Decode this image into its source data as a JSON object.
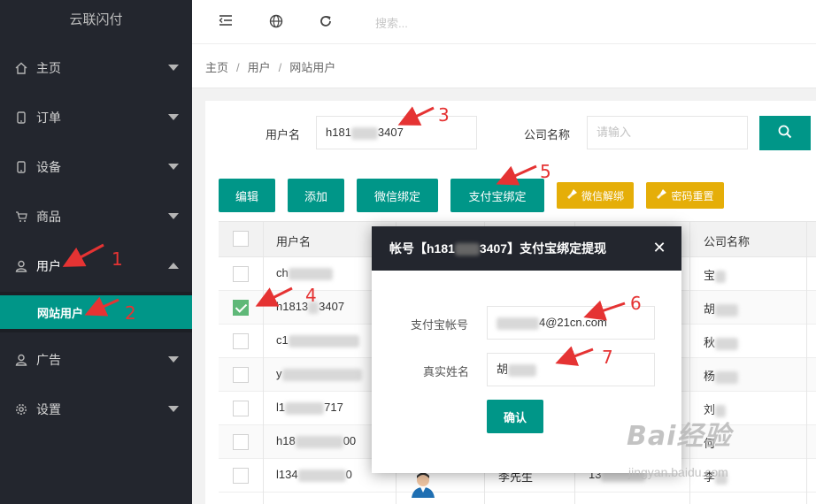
{
  "app": {
    "brand": "云联闪付"
  },
  "sidebar": {
    "items": [
      {
        "label": "主页",
        "icon": "home-icon"
      },
      {
        "label": "订单",
        "icon": "phone-icon"
      },
      {
        "label": "设备",
        "icon": "phone-icon"
      },
      {
        "label": "商品",
        "icon": "cart-icon"
      },
      {
        "label": "用户",
        "icon": "user-icon"
      },
      {
        "label": "广告",
        "icon": "user-icon"
      },
      {
        "label": "设置",
        "icon": "gear-icon"
      }
    ],
    "sub_item": "网站用户"
  },
  "header": {
    "search_placeholder": "搜索..."
  },
  "breadcrumb": {
    "home": "主页",
    "section": "用户",
    "current": "网站用户"
  },
  "filter": {
    "username_label": "用户名",
    "username_value_prefix": "h181",
    "username_value_suffix": "3407",
    "company_label": "公司名称",
    "company_placeholder": "请输入"
  },
  "toolbar": {
    "edit": "编辑",
    "add": "添加",
    "wechat_bind": "微信绑定",
    "alipay_bind": "支付宝绑定",
    "wechat_unbind": "微信解绑",
    "password_reset": "密码重置"
  },
  "table": {
    "headers": {
      "username": "用户名",
      "company": "公司名称"
    },
    "rows": [
      {
        "user": "ch",
        "company": "宝",
        "checked": false
      },
      {
        "user": "h1813",
        "user_suffix": "3407",
        "company": "胡",
        "checked": true
      },
      {
        "user": "c1",
        "company": "秋",
        "checked": false
      },
      {
        "user": "y",
        "company": "杨",
        "checked": false
      },
      {
        "user": "l1",
        "user_suffix": "717",
        "company": "刘",
        "checked": false
      },
      {
        "user": "h18",
        "user_suffix": "00",
        "company": "何",
        "checked": false
      },
      {
        "user": "l134",
        "user_suffix": "0",
        "name": "李先生",
        "phone": "13",
        "company": "李",
        "checked": false
      }
    ]
  },
  "dialog": {
    "title_prefix": "帐号【h181",
    "title_suffix": "3407】支付宝绑定提现",
    "alipay_label": "支付宝帐号",
    "alipay_value": "4@21cn.com",
    "name_label": "真实姓名",
    "name_value": "胡",
    "confirm": "确认"
  },
  "annotations": [
    "1",
    "2",
    "3",
    "4",
    "5",
    "6",
    "7"
  ],
  "watermark": {
    "main": "Bai经验",
    "sub": "jingyan.baidu.com"
  },
  "colors": {
    "primary": "#009688",
    "warn": "#e5ae08",
    "sidebar": "#23262e",
    "annotation": "#e53333"
  }
}
